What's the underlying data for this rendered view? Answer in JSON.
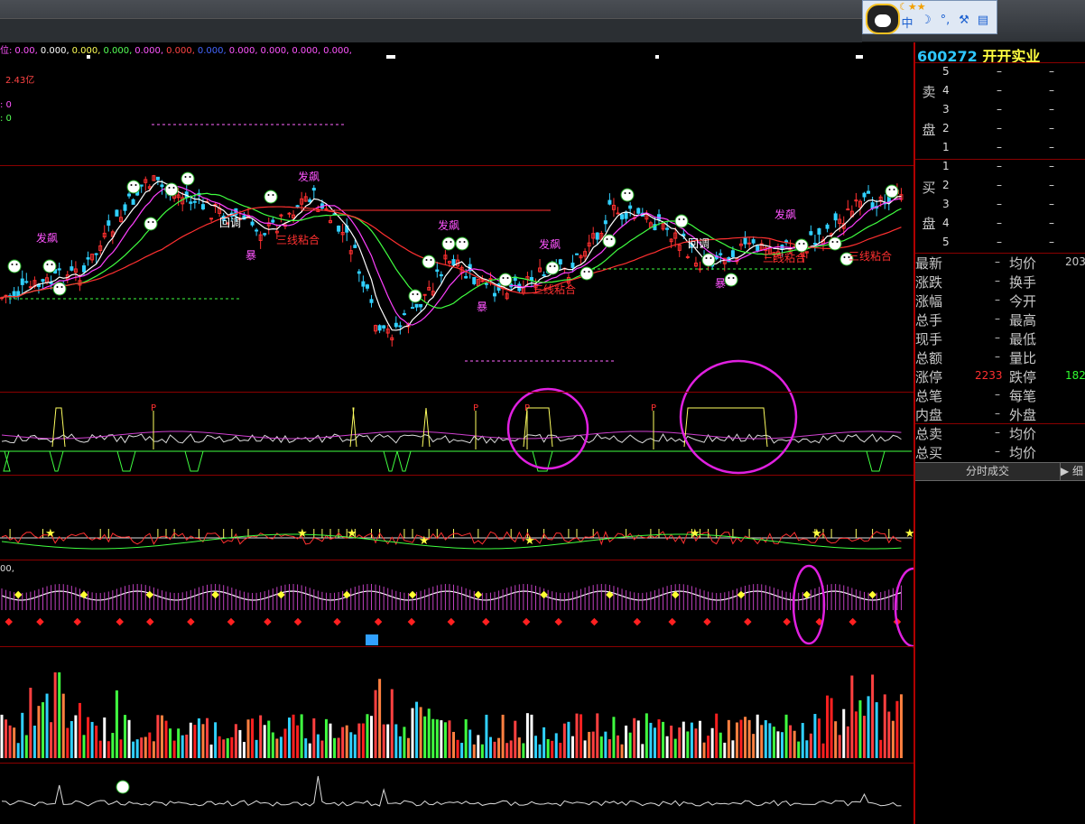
{
  "ma_label": {
    "prefix": "位:",
    "values": [
      {
        "text": "0.00,",
        "color": "#ff55ff"
      },
      {
        "text": "0.000,",
        "color": "#ffffff"
      },
      {
        "text": "0.000,",
        "color": "#ffff55"
      },
      {
        "text": "0.000,",
        "color": "#55ff55"
      },
      {
        "text": "0.000,",
        "color": "#ff55ff"
      },
      {
        "text": "0.000,",
        "color": "#ff4444"
      },
      {
        "text": "0.000,",
        "color": "#4466ff"
      },
      {
        "text": "0.000,",
        "color": "#ff55ff"
      },
      {
        "text": "0.000,",
        "color": "#ff55ff"
      },
      {
        "text": "0.000,",
        "color": "#ff55ff"
      },
      {
        "text": "0.000,",
        "color": "#ff55ff"
      }
    ]
  },
  "main": {
    "amount": "2.43亿",
    "side_a": ": 0",
    "side_b": ": 0",
    "pattern_labels": [
      "发飙",
      "发飙",
      "发飙",
      "发飙",
      "发飙",
      "回调",
      "回调",
      "暴",
      "暴",
      "暴",
      "三线粘合",
      "三线粘合",
      "三线粘合",
      "三线粘合"
    ]
  },
  "panel4_label": "00,",
  "quote": {
    "code": "600272",
    "name": "开开实业",
    "sell_label": [
      "卖",
      "盘"
    ],
    "buy_label": [
      "买",
      "盘"
    ],
    "sell": [
      {
        "level": "5",
        "price": "–",
        "vol": "–"
      },
      {
        "level": "4",
        "price": "–",
        "vol": "–"
      },
      {
        "level": "3",
        "price": "–",
        "vol": "–"
      },
      {
        "level": "2",
        "price": "–",
        "vol": "–"
      },
      {
        "level": "1",
        "price": "–",
        "vol": "–"
      }
    ],
    "buy": [
      {
        "level": "1",
        "price": "–",
        "vol": "–"
      },
      {
        "level": "2",
        "price": "–",
        "vol": "–"
      },
      {
        "level": "3",
        "price": "–",
        "vol": "–"
      },
      {
        "level": "4",
        "price": "–",
        "vol": "–"
      },
      {
        "level": "5",
        "price": "–",
        "vol": "–"
      }
    ],
    "stats": [
      {
        "l1": "最新",
        "v1": "–",
        "l2": "均价",
        "v2": "203"
      },
      {
        "l1": "涨跌",
        "v1": "–",
        "l2": "换手",
        "v2": ""
      },
      {
        "l1": "涨幅",
        "v1": "–",
        "l2": "今开",
        "v2": ""
      },
      {
        "l1": "总手",
        "v1": "–",
        "l2": "最高",
        "v2": ""
      },
      {
        "l1": "现手",
        "v1": "–",
        "l2": "最低",
        "v2": ""
      },
      {
        "l1": "总额",
        "v1": "–",
        "l2": "量比",
        "v2": ""
      },
      {
        "l1": "涨停",
        "v1": "2233",
        "l2": "跌停",
        "v2": "182"
      },
      {
        "l1": "总笔",
        "v1": "–",
        "l2": "每笔",
        "v2": ""
      },
      {
        "l1": "内盘",
        "v1": "–",
        "l2": "外盘",
        "v2": ""
      }
    ],
    "stats2": [
      {
        "l1": "总卖",
        "v1": "–",
        "l2": "均价",
        "v2": ""
      },
      {
        "l1": "总买",
        "v1": "–",
        "l2": "均价",
        "v2": ""
      }
    ],
    "tab": "分时成交",
    "tab2": "▶ 细",
    "limit_up_color": "#ff3030",
    "limit_down_color": "#30ff30"
  },
  "colors": {
    "up": "#ff3030",
    "down": "#30d0ff",
    "ma5": "#ffffff",
    "ma10": "#ffff40",
    "ma20": "#ff40ff",
    "ma30": "#40ff40",
    "ma60": "#ff3030",
    "circle": "#e020e0"
  }
}
